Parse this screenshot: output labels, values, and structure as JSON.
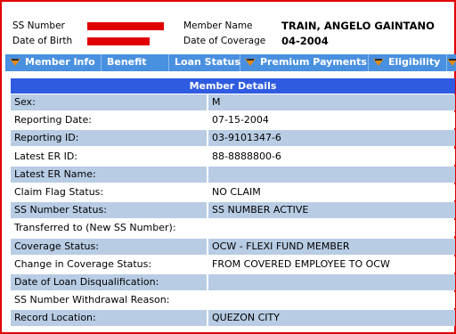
{
  "header": {
    "ss_number_label": "SS Number",
    "date_of_birth_label": "Date of Birth",
    "member_name_label": "Member Name",
    "member_name_value": "TRAIN, ANGELO GAINTANO",
    "date_of_coverage_label": "Date of Coverage",
    "date_of_coverage_value": "04-2004"
  },
  "tabs": [
    {
      "label": "Member Info",
      "has_arrow": true
    },
    {
      "label": "Benefit",
      "has_arrow": false
    },
    {
      "label": "Loan Status",
      "has_arrow": false
    },
    {
      "label": "Premium Payments",
      "has_arrow": true
    },
    {
      "label": "Eligibility",
      "has_arrow": true
    }
  ],
  "details": {
    "title": "Member Details",
    "rows": [
      {
        "label": "Sex:",
        "value": "M"
      },
      {
        "label": "Reporting Date:",
        "value": "07-15-2004"
      },
      {
        "label": "Reporting ID:",
        "value": "03-9101347-6"
      },
      {
        "label": "Latest ER ID:",
        "value": "88-8888800-6"
      },
      {
        "label": "Latest ER Name:",
        "value": ""
      },
      {
        "label": "Claim Flag Status:",
        "value": "NO CLAIM"
      },
      {
        "label": "SS Number Status:",
        "value": "SS NUMBER ACTIVE"
      },
      {
        "label": "Transferred to (New SS Number):",
        "value": ""
      },
      {
        "label": "Coverage Status:",
        "value": "OCW - FLEXI FUND MEMBER"
      },
      {
        "label": "Change in Coverage Status:",
        "value": "FROM COVERED EMPLOYEE TO OCW"
      },
      {
        "label": "Date of Loan Disqualification:",
        "value": ""
      },
      {
        "label": "SS Number Withdrawal Reason:",
        "value": ""
      },
      {
        "label": "Record Location:",
        "value": "QUEZON CITY"
      }
    ]
  },
  "colors": {
    "frame_border": "#e00000",
    "redaction": "#e00000",
    "tab_bar": "#4a90e0",
    "title_bar": "#2f5be0",
    "row_shade": "#b8cce4"
  }
}
